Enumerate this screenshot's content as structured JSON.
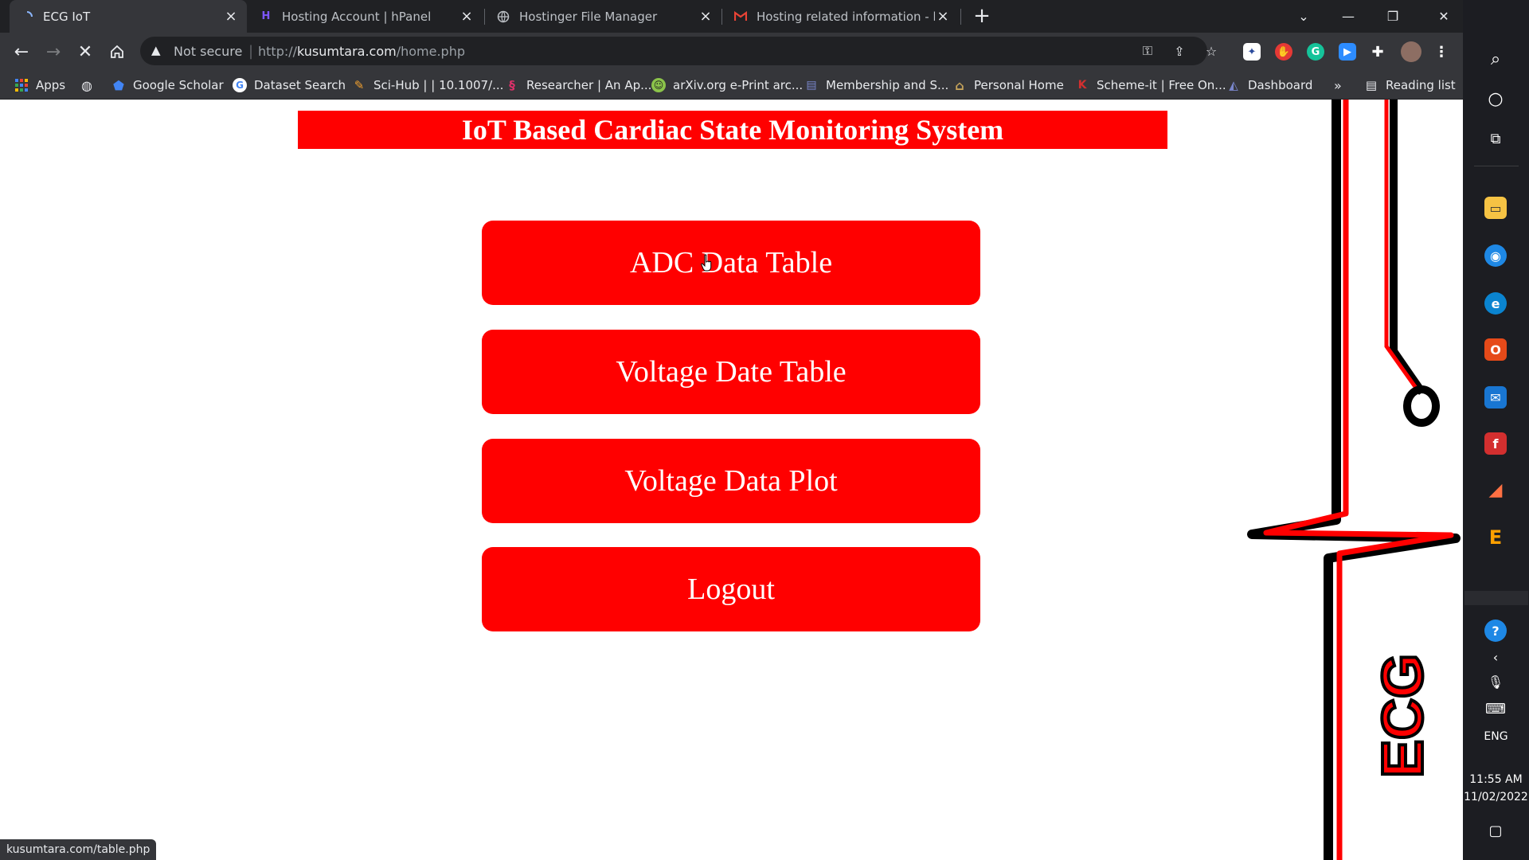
{
  "tabs": [
    {
      "title": "ECG IoT",
      "active": true,
      "icon": "loading-icon"
    },
    {
      "title": "Hosting Account | hPanel",
      "active": false,
      "icon": "hostinger-icon"
    },
    {
      "title": "Hostinger File Manager",
      "active": false,
      "icon": "globe-icon"
    },
    {
      "title": "Hosting related information - hr...",
      "active": false,
      "icon": "gmail-icon"
    }
  ],
  "toolbar": {
    "security_label": "Not secure",
    "url_prefix": "http://",
    "url_domain": "kusumtara.com",
    "url_path": "/home.php"
  },
  "bookmarks": [
    {
      "label": "Apps",
      "icon": "apps-grid-icon",
      "color": "#4285f4"
    },
    {
      "label": "",
      "icon": "globe-icon",
      "color": "#e8eaed"
    },
    {
      "label": "Google Scholar",
      "icon": "scholar-icon",
      "color": "#4285f4"
    },
    {
      "label": "Dataset Search",
      "icon": "google-icon",
      "color": "#ffffff"
    },
    {
      "label": "Sci-Hub | | 10.1007/...",
      "icon": "scihub-icon",
      "color": "#f0a030"
    },
    {
      "label": "Researcher | An Ap...",
      "icon": "researcher-icon",
      "color": "#e0306a"
    },
    {
      "label": "arXiv.org e-Print arc...",
      "icon": "arxiv-icon",
      "color": "#8bc34a"
    },
    {
      "label": "Membership and S...",
      "icon": "ieee-icon",
      "color": "#3f51b5"
    },
    {
      "label": "Personal Home",
      "icon": "home-icon",
      "color": "#c5a35a"
    },
    {
      "label": "Scheme-it | Free On...",
      "icon": "digikey-icon",
      "color": "#d32f2f"
    },
    {
      "label": "Dashboard",
      "icon": "dashboard-icon",
      "color": "#7986cb"
    }
  ],
  "bookmarks_overflow": "»",
  "reading_list": "Reading list",
  "page": {
    "banner_title": "IoT Based Cardiac State Monitoring System",
    "buttons": [
      {
        "label": "ADC Data Table"
      },
      {
        "label": "Voltage Date Table"
      },
      {
        "label": "Voltage Data Plot"
      },
      {
        "label": "Logout"
      }
    ],
    "side_art_text": "ECG",
    "accent_color": "#ff0000"
  },
  "status_url": "kusumtara.com/table.php",
  "taskbar": {
    "language": "ENG",
    "time": "11:55 AM",
    "date": "11/02/2022"
  }
}
